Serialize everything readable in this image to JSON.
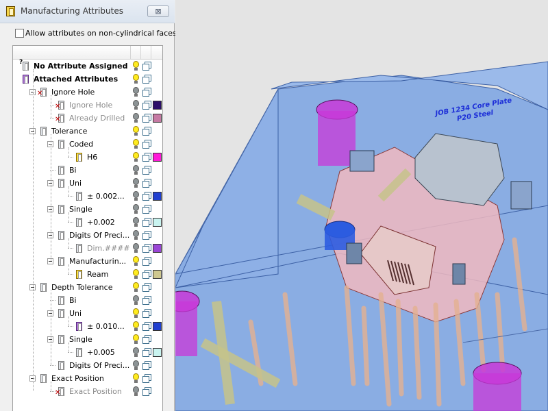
{
  "window": {
    "title": "Manufacturing Attributes",
    "close_symbol": "⊠"
  },
  "options": {
    "allow_non_cylindrical_label": "Allow attributes on non-cylindrical faces",
    "allow_non_cylindrical_checked": false
  },
  "tree": {
    "rows": [
      {
        "label": "No Attribute Assigned",
        "bold": true,
        "dim": false,
        "icon": "question-tag-icon",
        "bulb": "on",
        "cube": "blue",
        "swatch": null
      },
      {
        "label": "Attached Attributes",
        "bold": true,
        "dim": false,
        "icon": "purple-tag-icon",
        "bulb": "on",
        "cube": "blue",
        "swatch": null
      },
      {
        "label": "Ignore Hole",
        "bold": false,
        "dim": false,
        "icon": "ignore-hole-icon",
        "bulb": "off",
        "cube": "blue",
        "swatch": null
      },
      {
        "label": "Ignore Hole",
        "bold": false,
        "dim": true,
        "icon": "ignore-hole-icon",
        "bulb": "off",
        "cube": "blue",
        "swatch": "#2c0f6a"
      },
      {
        "label": "Already Drilled",
        "bold": false,
        "dim": true,
        "icon": "ignore-hole-icon",
        "bulb": "off",
        "cube": "blue",
        "swatch": "#c67aa4"
      },
      {
        "label": "Tolerance",
        "bold": false,
        "dim": false,
        "icon": "tag-icon",
        "bulb": "on",
        "cube": "blue",
        "swatch": null
      },
      {
        "label": "Coded",
        "bold": false,
        "dim": false,
        "icon": "tag-icon",
        "bulb": "on",
        "cube": "blue",
        "swatch": null
      },
      {
        "label": "H6",
        "bold": false,
        "dim": false,
        "icon": "yellow-tag-icon",
        "bulb": "on",
        "cube": "blue",
        "swatch": "#ff1ad9"
      },
      {
        "label": "Bi",
        "bold": false,
        "dim": false,
        "icon": "tag-icon",
        "bulb": "off",
        "cube": "blue",
        "swatch": null
      },
      {
        "label": "Uni",
        "bold": false,
        "dim": false,
        "icon": "tag-icon",
        "bulb": "off",
        "cube": "blue",
        "swatch": null
      },
      {
        "label": "± 0.002...",
        "bold": false,
        "dim": false,
        "icon": "tag-icon",
        "bulb": "off",
        "cube": "blue",
        "swatch": "#1f3fd0"
      },
      {
        "label": "Single",
        "bold": false,
        "dim": false,
        "icon": "tag-icon",
        "bulb": "off",
        "cube": "blue",
        "swatch": null
      },
      {
        "label": "+0.002",
        "bold": false,
        "dim": false,
        "icon": "tag-icon",
        "bulb": "off",
        "cube": "blue",
        "swatch": "#c9f4f0"
      },
      {
        "label": "Digits Of Preci...",
        "bold": false,
        "dim": false,
        "icon": "tag-icon",
        "bulb": "off",
        "cube": "blue",
        "swatch": null
      },
      {
        "label": "Dim.####",
        "bold": false,
        "dim": true,
        "icon": "tag-icon",
        "bulb": "off",
        "cube": "blue",
        "swatch": "#9a46d6"
      },
      {
        "label": "Manufacturin...",
        "bold": false,
        "dim": false,
        "icon": "tag-icon",
        "bulb": "on",
        "cube": "blue",
        "swatch": null
      },
      {
        "label": "Ream",
        "bold": false,
        "dim": false,
        "icon": "yellow-tag-icon",
        "bulb": "on",
        "cube": "blue",
        "swatch": "#cfc88f"
      },
      {
        "label": "Depth Tolerance",
        "bold": false,
        "dim": false,
        "icon": "tag-icon",
        "bulb": "on",
        "cube": "blue",
        "swatch": null
      },
      {
        "label": "Bi",
        "bold": false,
        "dim": false,
        "icon": "tag-icon",
        "bulb": "off",
        "cube": "blue",
        "swatch": null
      },
      {
        "label": "Uni",
        "bold": false,
        "dim": false,
        "icon": "tag-icon",
        "bulb": "on",
        "cube": "blue",
        "swatch": null
      },
      {
        "label": "± 0.010...",
        "bold": false,
        "dim": false,
        "icon": "purple-tag-icon",
        "bulb": "on",
        "cube": "blue",
        "swatch": "#1f3fd0"
      },
      {
        "label": "Single",
        "bold": false,
        "dim": false,
        "icon": "tag-icon",
        "bulb": "on",
        "cube": "blue",
        "swatch": null
      },
      {
        "label": "+0.005",
        "bold": false,
        "dim": false,
        "icon": "tag-icon",
        "bulb": "off",
        "cube": "blue",
        "swatch": "#c9f4f0"
      },
      {
        "label": "Digits Of Preci...",
        "bold": false,
        "dim": false,
        "icon": "tag-icon",
        "bulb": "off",
        "cube": "blue",
        "swatch": null
      },
      {
        "label": "Exact Position",
        "bold": false,
        "dim": false,
        "icon": "tag-icon",
        "bulb": "on",
        "cube": "blue",
        "swatch": null
      },
      {
        "label": "Exact Position",
        "bold": false,
        "dim": true,
        "icon": "ignore-hole-icon",
        "bulb": "off",
        "cube": "blue",
        "swatch": null
      }
    ]
  },
  "viewport": {
    "part_label_line1": "JOB 1234 Core Plate",
    "part_label_line2": "P20 Steel",
    "colors": {
      "plate": "#7fa6e2",
      "pocket": "#f0b8c0",
      "pins": "#e4b090",
      "magenta_holes": "#c838d8",
      "khaki_pins": "#c6c38a"
    }
  }
}
